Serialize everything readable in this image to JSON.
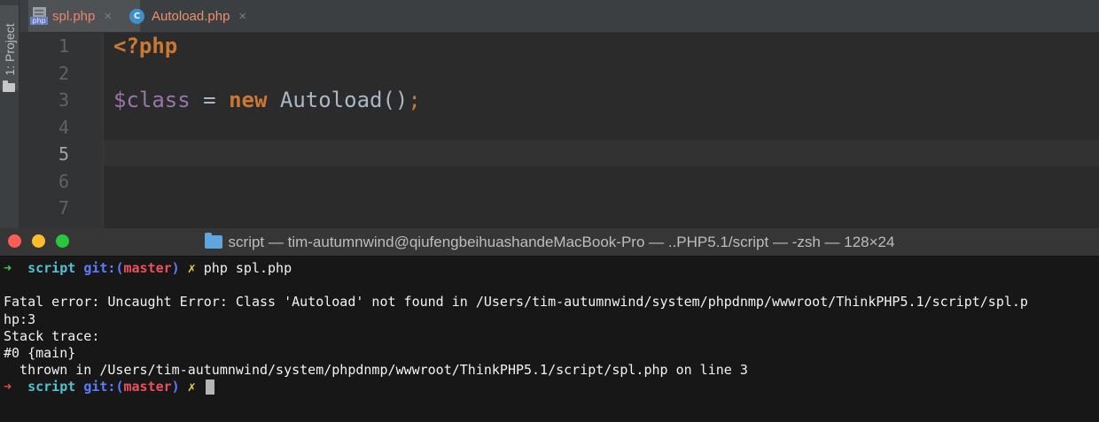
{
  "ide": {
    "project_label": "1: Project",
    "tabs": [
      {
        "label": "spl.php",
        "icon": "php-file-icon",
        "close": "×"
      },
      {
        "label": "Autoload.php",
        "icon": "class-icon",
        "icon_text": "C",
        "close": "×"
      }
    ],
    "php_icon_text": "php",
    "line_numbers": [
      "1",
      "2",
      "3",
      "4",
      "5",
      "6",
      "7"
    ],
    "current_line": "5",
    "code": {
      "line1": "<?php",
      "line3": {
        "var": "$class",
        "op": " = ",
        "kw": "new",
        "rest": " Autoload()",
        "semi": ";"
      }
    }
  },
  "terminal": {
    "title": "script — tim-autumnwind@qiufengbeihuashandeMacBook-Pro — ..PHP5.1/script — -zsh — 128×24",
    "prompt": {
      "arrow": "➜",
      "dir": "script",
      "git": "git:",
      "branch_open": "(",
      "branch": "master",
      "branch_close": ")",
      "dirty": "✗"
    },
    "command": "php spl.php",
    "output": [
      "",
      "Fatal error: Uncaught Error: Class 'Autoload' not found in /Users/tim-autumnwind/system/phpdnmp/wwwroot/ThinkPHP5.1/script/spl.p",
      "hp:3",
      "Stack trace:",
      "#0 {main}",
      "  thrown in /Users/tim-autumnwind/system/phpdnmp/wwwroot/ThinkPHP5.1/script/spl.php on line 3"
    ]
  },
  "colors": {
    "ide_bg": "#2b2b2b",
    "terminal_bg": "#171717",
    "prompt_ok": "#3ed13e",
    "prompt_err": "#e0523d",
    "php_keyword": "#cc7832",
    "php_variable": "#9876aa"
  }
}
